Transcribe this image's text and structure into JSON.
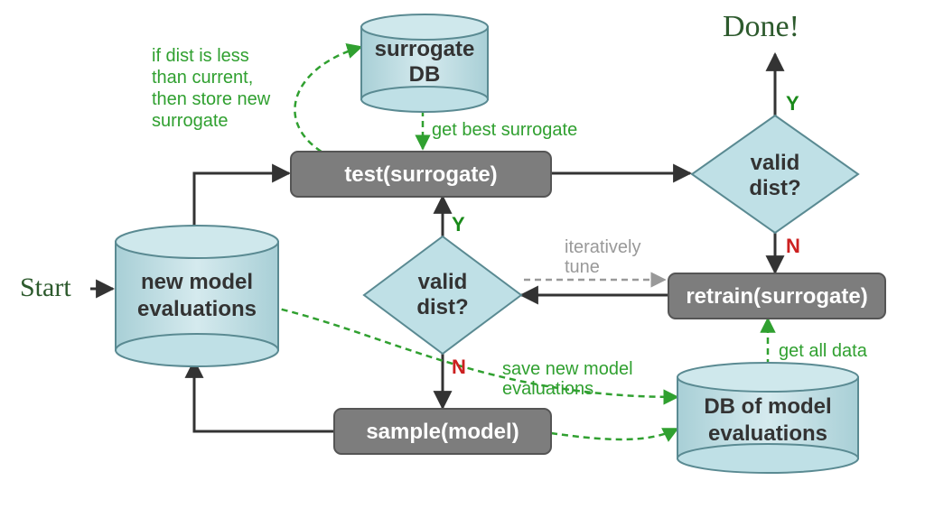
{
  "title_start": "Start",
  "title_done": "Done!",
  "nodes": {
    "new_model_eval": {
      "line1": "new model",
      "line2": "evaluations"
    },
    "surrogate_db": {
      "line1": "surrogate",
      "line2": "DB"
    },
    "db_model_eval": {
      "line1": "DB of model",
      "line2": "evaluations"
    },
    "test_surrogate": "test(surrogate)",
    "retrain_surrogate": "retrain(surrogate)",
    "sample_model": "sample(model)",
    "valid_dist_center": "valid dist?",
    "valid_dist_right": "valid dist?"
  },
  "annotations": {
    "store_new": {
      "l1": "if dist is less",
      "l2": "than current,",
      "l3": "then store new",
      "l4": "surrogate"
    },
    "get_best": "get best surrogate",
    "iter_tune": {
      "l1": "iteratively",
      "l2": "tune"
    },
    "save_new": {
      "l1": "save new model",
      "l2": "evaluations"
    },
    "get_all": "get all data"
  },
  "labels": {
    "Y": "Y",
    "N": "N"
  }
}
